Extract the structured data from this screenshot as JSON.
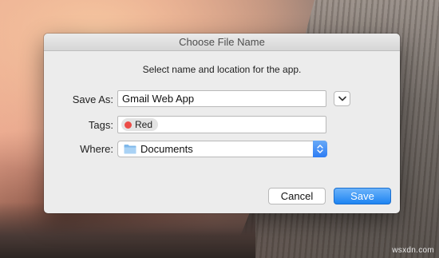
{
  "dialog": {
    "title": "Choose File Name",
    "subtitle": "Select name and location for the app.",
    "save_as": {
      "label": "Save As:",
      "value": "Gmail Web App"
    },
    "tags": {
      "label": "Tags:",
      "items": [
        {
          "label": "Red",
          "color": "#ec4c47"
        }
      ]
    },
    "where": {
      "label": "Where:",
      "selected": "Documents",
      "icon": "folder-icon"
    },
    "buttons": {
      "cancel": "Cancel",
      "save": "Save"
    }
  },
  "watermark": "wsxdn.com",
  "colors": {
    "accent": "#1e84f2",
    "dialog_bg": "#ececec"
  }
}
